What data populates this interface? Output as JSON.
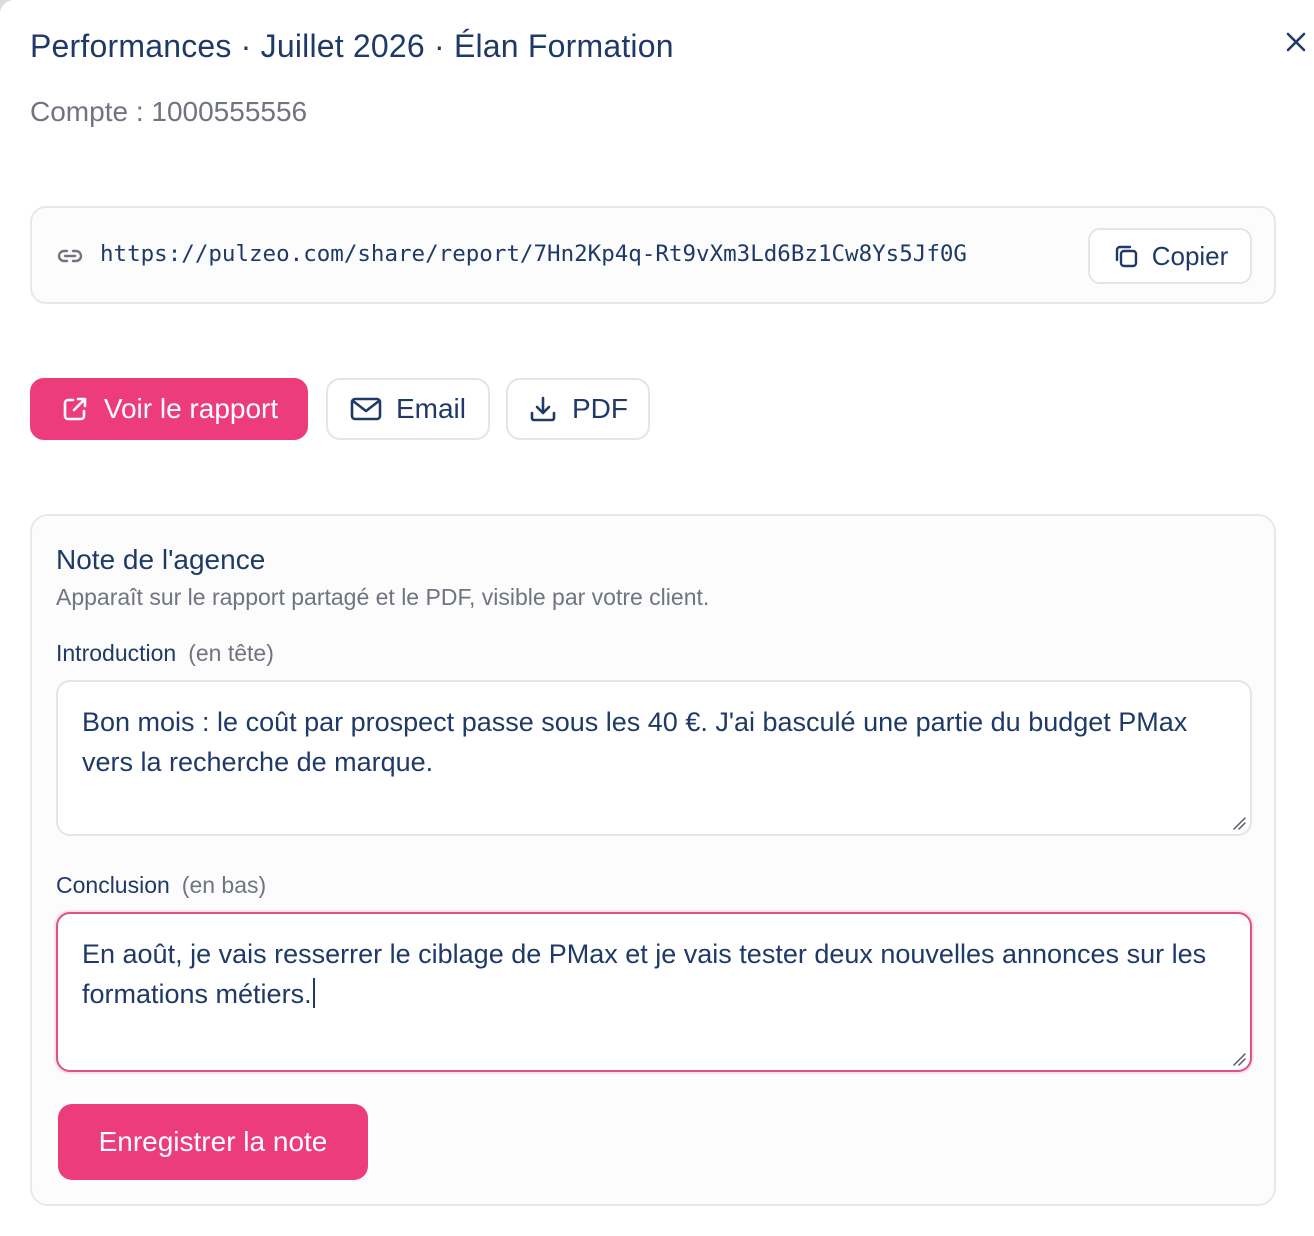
{
  "dialog": {
    "title": "Performances · Juillet 2026 · Élan Formation",
    "account": "Compte : 1000555556",
    "close_icon": "close-icon"
  },
  "share": {
    "icon": "link-icon",
    "url": "https://pulzeo.com/share/report/7Hn2Kp4q-Rt9vXm3Ld6Bz1Cw8Ys5Jf0G",
    "copy_label": "Copier",
    "copy_icon": "copy-icon"
  },
  "actions": {
    "view_report": {
      "label": "Voir le rapport",
      "icon": "external-link-icon"
    },
    "email": {
      "label": "Email",
      "icon": "mail-icon"
    },
    "pdf": {
      "label": "PDF",
      "icon": "download-icon"
    }
  },
  "note": {
    "title": "Note de l'agence",
    "description": "Apparaît sur le rapport partagé et le PDF, visible par votre client.",
    "introduction": {
      "label": "Introduction",
      "hint": "(en tête)",
      "value": "Bon mois : le coût par prospect passe sous les 40 €. J'ai basculé une partie du budget PMax vers la recherche de marque."
    },
    "conclusion": {
      "label": "Conclusion",
      "hint": "(en bas)",
      "value": "En août, je vais resserrer le ciblage de PMax et je vais tester deux nouvelles annonces sur les formations métiers.",
      "focused": true
    },
    "save_label": "Enregistrer la note"
  },
  "colors": {
    "primary": "#ec3c7c",
    "text": "#1f3a68",
    "muted": "#6f7480",
    "border": "#e3e5e9",
    "focus_border": "#e0527f"
  }
}
